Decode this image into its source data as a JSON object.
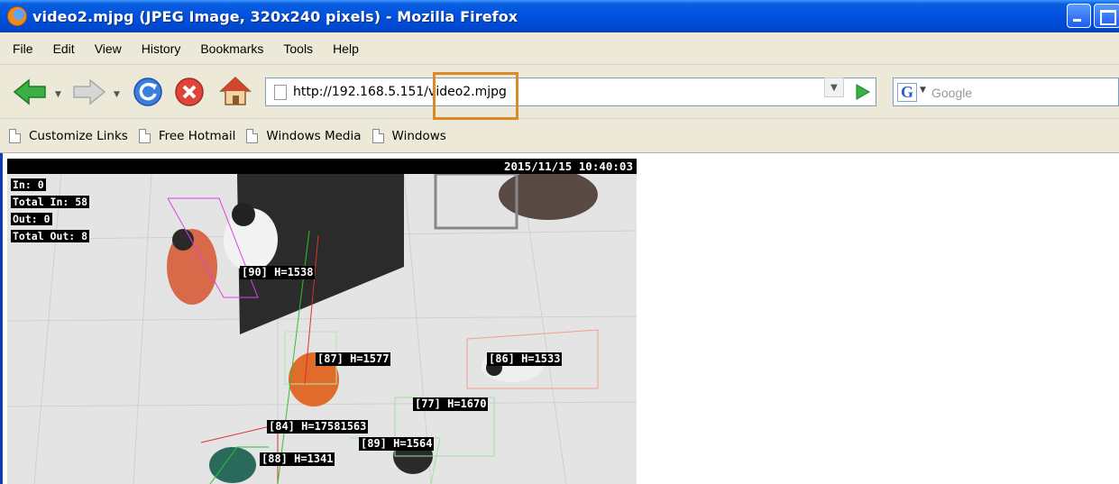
{
  "window": {
    "title": "video2.mjpg (JPEG Image, 320x240 pixels) - Mozilla Firefox"
  },
  "menu": {
    "items": [
      "File",
      "Edit",
      "View",
      "History",
      "Bookmarks",
      "Tools",
      "Help"
    ]
  },
  "navigation": {
    "url_prefix": "http://192.168.5.151/",
    "url_file": "video2.mjpg",
    "search_placeholder": "Google"
  },
  "bookmarks": {
    "items": [
      "Customize Links",
      "Free Hotmail",
      "Windows Media",
      "Windows"
    ]
  },
  "video": {
    "timestamp": "2015/11/15 10:40:03",
    "stats": [
      "In: 0",
      "Total In: 58",
      "Out: 0",
      "Total Out: 8"
    ],
    "tracks": [
      {
        "label": "[90] H=1538",
        "color": "#e040e0"
      },
      {
        "label": "[87] H=1577",
        "color": "#b0e8b0"
      },
      {
        "label": "[86] H=1533",
        "color": "#f0a090"
      },
      {
        "label": "[77] H=1670",
        "color": "#a0e0a0"
      },
      {
        "label": "[84] H=17581563",
        "color": "#e03030"
      },
      {
        "label": "[89] H=1564",
        "color": "#a0e0a0"
      },
      {
        "label": "[88] H=1341",
        "color": "#30c030"
      }
    ]
  },
  "colors": {
    "titlebar": "#0050dd",
    "chrome": "#ece9d8",
    "highlight": "#d98a2b"
  }
}
